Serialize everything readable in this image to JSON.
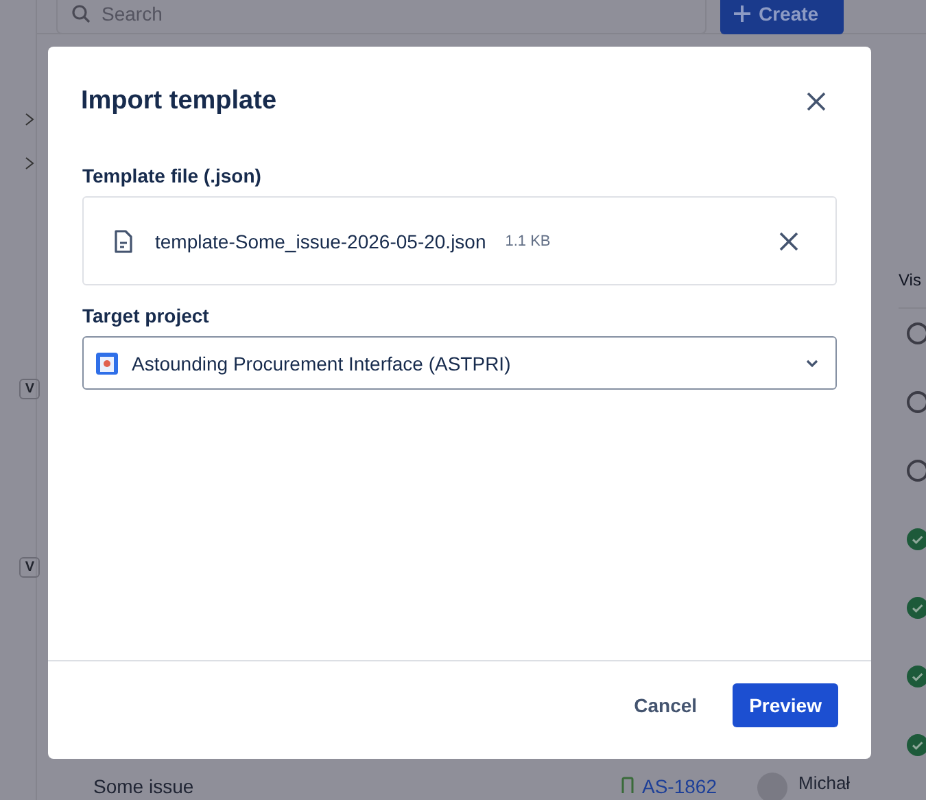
{
  "background": {
    "search": {
      "placeholder": "Search"
    },
    "create_button": "Create",
    "sidebar_badges": [
      "V",
      "V"
    ],
    "column_header": "Vis",
    "statuses": [
      {
        "done": false
      },
      {
        "done": false
      },
      {
        "done": false
      },
      {
        "done": true
      },
      {
        "done": true
      },
      {
        "done": true
      },
      {
        "done": true
      }
    ],
    "row": {
      "summary": "Some issue",
      "key": "AS-1862",
      "assignee": "Michał"
    }
  },
  "dialog": {
    "title": "Import template",
    "file_label": "Template file (.json)",
    "file": {
      "name": "template-Some_issue-2026-05-20.json",
      "size": "1.1 KB"
    },
    "project_label": "Target project",
    "project": {
      "value": "Astounding Procurement Interface (ASTPRI)"
    },
    "buttons": [
      {
        "label": "Cancel",
        "kind": "subtle"
      },
      {
        "label": "Preview",
        "kind": "primary"
      }
    ]
  }
}
